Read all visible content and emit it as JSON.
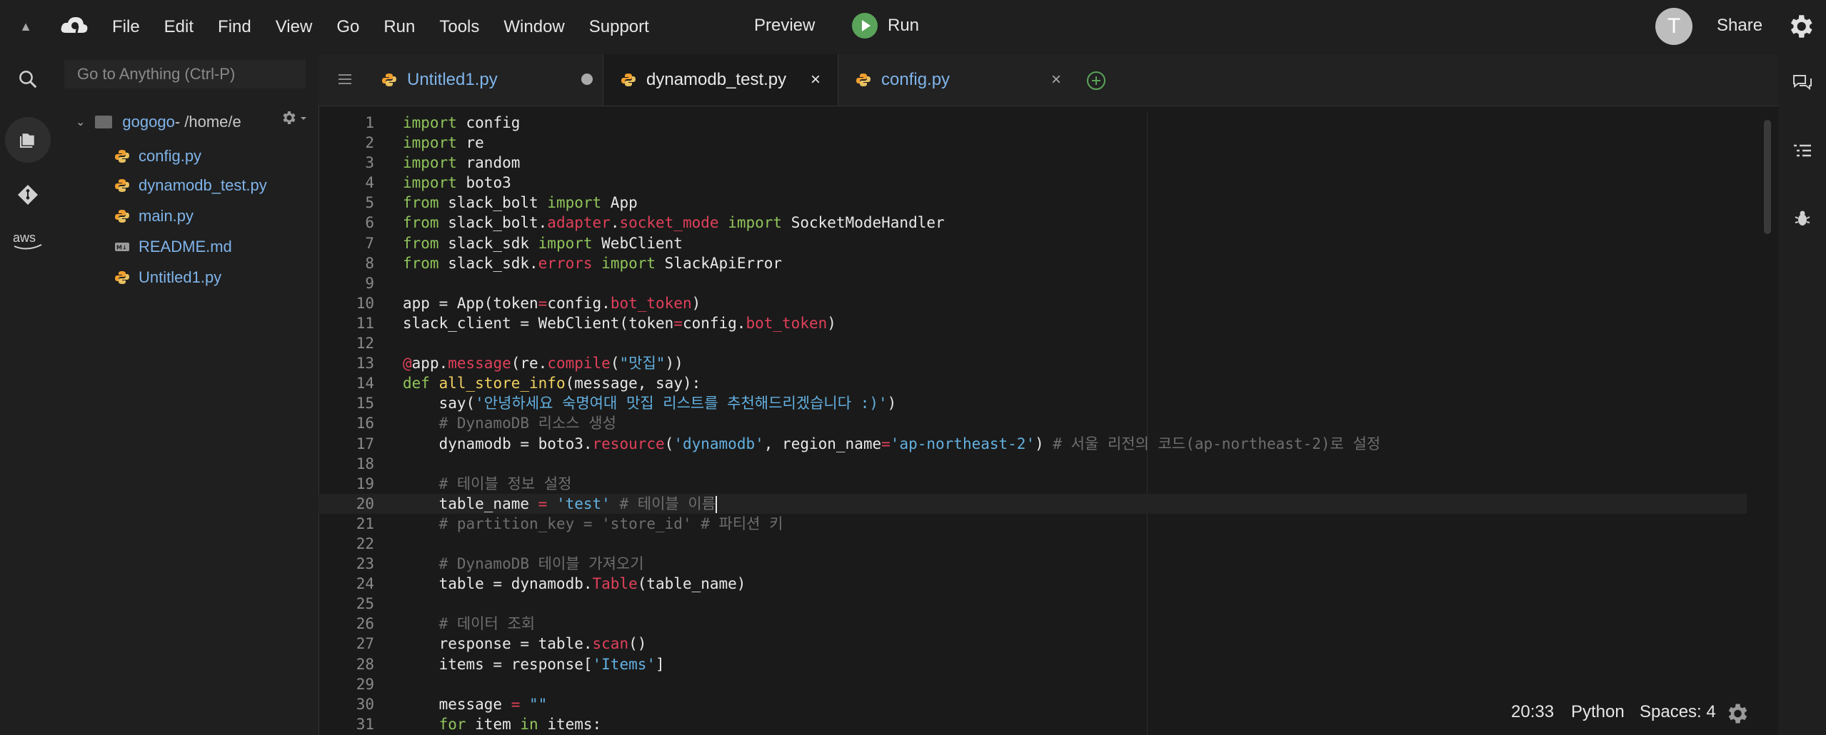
{
  "menu": {
    "items": [
      "File",
      "Edit",
      "Find",
      "View",
      "Go",
      "Run",
      "Tools",
      "Window",
      "Support"
    ],
    "preview": "Preview",
    "run": "Run",
    "avatar_letter": "T",
    "share": "Share"
  },
  "sidebar": {
    "goto_placeholder": "Go to Anything (Ctrl-P)",
    "root_name": "gogogo",
    "root_path": " - /home/e",
    "files": [
      {
        "name": "config.py",
        "icon": "python-icon"
      },
      {
        "name": "dynamodb_test.py",
        "icon": "python-icon"
      },
      {
        "name": "main.py",
        "icon": "python-icon"
      },
      {
        "name": "README.md",
        "icon": "markdown-icon"
      },
      {
        "name": "Untitled1.py",
        "icon": "python-icon"
      }
    ]
  },
  "tabs": [
    {
      "label": "Untitled1.py",
      "modified": true
    },
    {
      "label": "dynamodb_test.py",
      "active": true
    },
    {
      "label": "config.py"
    }
  ],
  "tab_close": "×",
  "status": {
    "position": "20:33",
    "language": "Python",
    "spaces": "Spaces: 4"
  },
  "code": [
    {
      "n": "1",
      "t": [
        [
          "k",
          "import"
        ],
        [
          "",
          "config"
        ]
      ]
    },
    {
      "n": "2",
      "t": [
        [
          "k",
          "import"
        ],
        [
          "",
          "re"
        ]
      ]
    },
    {
      "n": "3",
      "t": [
        [
          "k",
          "import"
        ],
        [
          "",
          "random"
        ]
      ]
    },
    {
      "n": "4",
      "t": [
        [
          "k",
          "import"
        ],
        [
          "",
          "boto3"
        ]
      ]
    },
    {
      "n": "5",
      "t": [
        [
          "k",
          "from"
        ],
        [
          "",
          " slack_bolt "
        ],
        [
          "k",
          "import"
        ],
        [
          "",
          " App"
        ]
      ]
    },
    {
      "n": "6",
      "t": [
        [
          "k",
          "from"
        ],
        [
          "",
          " slack_bolt."
        ],
        [
          "r",
          "adapter"
        ],
        [
          "",
          "."
        ],
        [
          "r",
          "socket_mode"
        ],
        [
          "",
          " "
        ],
        [
          "k",
          "import"
        ],
        [
          "",
          " SocketModeHandler"
        ]
      ]
    },
    {
      "n": "7",
      "t": [
        [
          "k",
          "from"
        ],
        [
          "",
          " slack_sdk "
        ],
        [
          "k",
          "import"
        ],
        [
          "",
          " WebClient"
        ]
      ]
    },
    {
      "n": "8",
      "t": [
        [
          "k",
          "from"
        ],
        [
          "",
          " slack_sdk."
        ],
        [
          "r",
          "errors"
        ],
        [
          "",
          " "
        ],
        [
          "k",
          "import"
        ],
        [
          "",
          " SlackApiError"
        ]
      ]
    },
    {
      "n": "9",
      "t": []
    },
    {
      "n": "10",
      "t": [
        [
          "",
          "app = App(token"
        ],
        [
          "r",
          "="
        ],
        [
          "",
          "config."
        ],
        [
          "r",
          "bot_token"
        ],
        [
          "",
          ")"
        ]
      ]
    },
    {
      "n": "11",
      "t": [
        [
          "",
          "slack_client = WebClient(token"
        ],
        [
          "r",
          "="
        ],
        [
          "",
          "config."
        ],
        [
          "r",
          "bot_token"
        ],
        [
          "",
          ")"
        ]
      ]
    },
    {
      "n": "12",
      "t": []
    },
    {
      "n": "13",
      "t": [
        [
          "r",
          "@"
        ],
        [
          "",
          "app."
        ],
        [
          "r",
          "message"
        ],
        [
          "",
          "(re."
        ],
        [
          "r",
          "compile"
        ],
        [
          "",
          "("
        ],
        [
          "s",
          "\"맛집\""
        ],
        [
          "",
          "))"
        ]
      ]
    },
    {
      "n": "14",
      "t": [
        [
          "k",
          "def"
        ],
        [
          "",
          " "
        ],
        [
          "d",
          "all_store_info"
        ],
        [
          "",
          "(message, say):"
        ]
      ]
    },
    {
      "n": "15",
      "t": [
        [
          "",
          "    say("
        ],
        [
          "s",
          "'안녕하세요 숙명여대 맛집 리스트를 추천해드리겠습니다 :)'"
        ],
        [
          "",
          ")"
        ]
      ]
    },
    {
      "n": "16",
      "t": [
        [
          "",
          "    "
        ],
        [
          "c",
          "# DynamoDB 리소스 생성"
        ]
      ]
    },
    {
      "n": "17",
      "t": [
        [
          "",
          "    dynamodb = boto3."
        ],
        [
          "r",
          "resource"
        ],
        [
          "",
          "("
        ],
        [
          "s",
          "'dynamodb'"
        ],
        [
          "",
          ", region_name"
        ],
        [
          "r",
          "="
        ],
        [
          "s",
          "'ap-northeast-2'"
        ],
        [
          "",
          ") "
        ],
        [
          "c",
          "# 서울 리전의 코드(ap-northeast-2)로 설정"
        ]
      ]
    },
    {
      "n": "18",
      "t": []
    },
    {
      "n": "19",
      "t": [
        [
          "",
          "    "
        ],
        [
          "c",
          "# 테이블 정보 설정"
        ]
      ]
    },
    {
      "n": "20",
      "t": [
        [
          "",
          "    table_name "
        ],
        [
          "r",
          "="
        ],
        [
          "",
          " "
        ],
        [
          "s",
          "'test'"
        ],
        [
          "",
          " "
        ],
        [
          "c",
          "# 테이블 이름"
        ]
      ],
      "cur": true
    },
    {
      "n": "21",
      "t": [
        [
          "",
          "    "
        ],
        [
          "c",
          "# partition_key = 'store_id' # 파티션 키"
        ]
      ]
    },
    {
      "n": "22",
      "t": []
    },
    {
      "n": "23",
      "t": [
        [
          "",
          "    "
        ],
        [
          "c",
          "# DynamoDB 테이블 가져오기"
        ]
      ]
    },
    {
      "n": "24",
      "t": [
        [
          "",
          "    table = dynamodb."
        ],
        [
          "r",
          "Table"
        ],
        [
          "",
          "(table_name)"
        ]
      ]
    },
    {
      "n": "25",
      "t": []
    },
    {
      "n": "26",
      "t": [
        [
          "",
          "    "
        ],
        [
          "c",
          "# 데이터 조회"
        ]
      ]
    },
    {
      "n": "27",
      "t": [
        [
          "",
          "    response = table."
        ],
        [
          "r",
          "scan"
        ],
        [
          "",
          "()"
        ]
      ]
    },
    {
      "n": "28",
      "t": [
        [
          "",
          "    items = response["
        ],
        [
          "s",
          "'Items'"
        ],
        [
          "",
          "]"
        ]
      ]
    },
    {
      "n": "29",
      "t": []
    },
    {
      "n": "30",
      "t": [
        [
          "",
          "    message "
        ],
        [
          "r",
          "="
        ],
        [
          "",
          " "
        ],
        [
          "s",
          "\"\""
        ]
      ]
    },
    {
      "n": "31",
      "t": [
        [
          "",
          "    "
        ],
        [
          "k",
          "for"
        ],
        [
          "",
          " item "
        ],
        [
          "k",
          "in"
        ],
        [
          "",
          " items:"
        ]
      ]
    }
  ],
  "colors": {
    "keyword": "#90c45a",
    "string": "#63b0e0",
    "attr": "#e0405a",
    "func": "#f0d060",
    "comment": "#6e6e6e"
  }
}
